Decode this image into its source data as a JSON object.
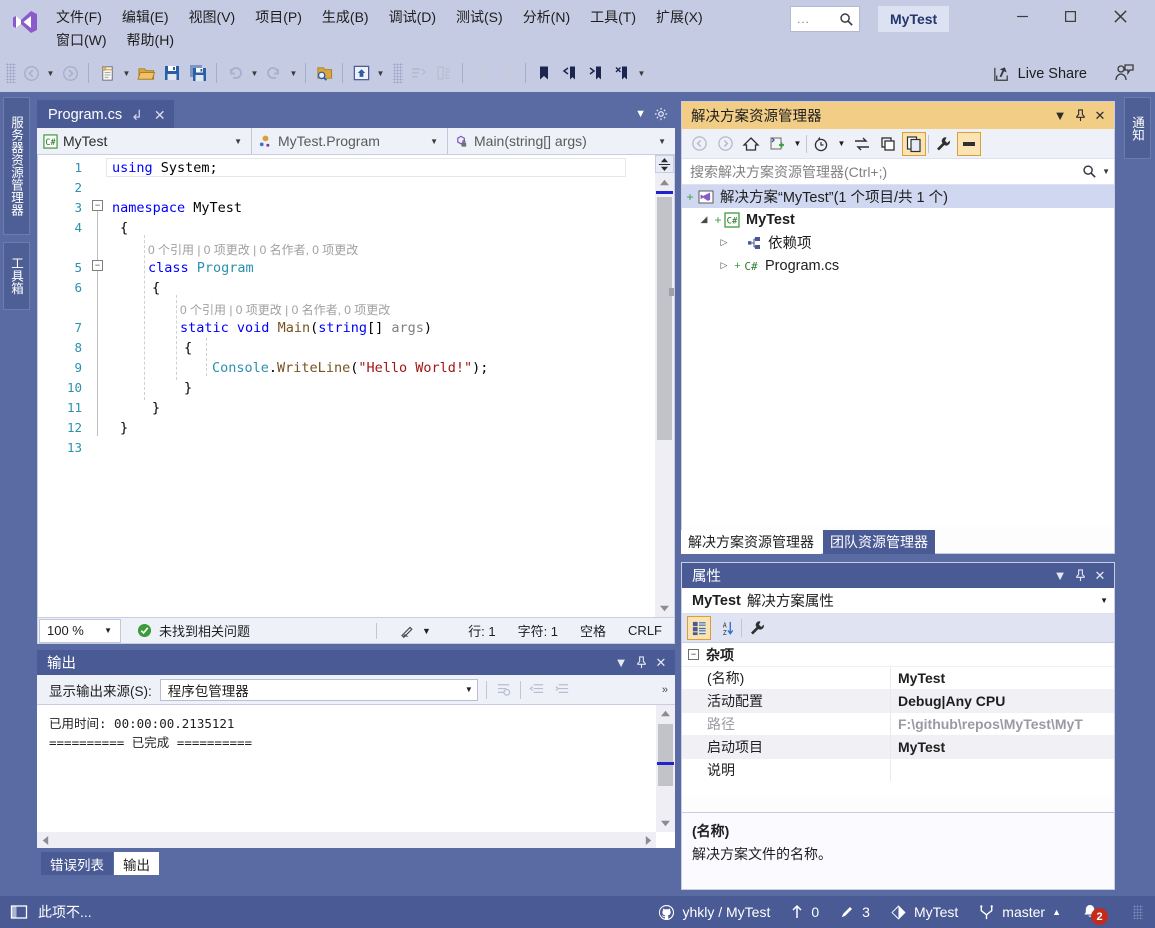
{
  "window": {
    "title": "MyTest",
    "minimize_label": "–",
    "maximize_label": "☐",
    "close_label": "✕"
  },
  "menu": {
    "row1": [
      {
        "label": "文件(F)",
        "key": "F"
      },
      {
        "label": "编辑(E)",
        "key": "E"
      },
      {
        "label": "视图(V)",
        "key": "V"
      },
      {
        "label": "项目(P)",
        "key": "P"
      },
      {
        "label": "生成(B)",
        "key": "B"
      },
      {
        "label": "调试(D)",
        "key": "D"
      },
      {
        "label": "测试(S)",
        "key": "S"
      },
      {
        "label": "分析(N)",
        "key": "N"
      },
      {
        "label": "工具(T)",
        "key": "T"
      },
      {
        "label": "扩展(X)",
        "key": "X"
      }
    ],
    "row2": [
      {
        "label": "窗口(W)",
        "key": "W"
      },
      {
        "label": "帮助(H)",
        "key": "H"
      }
    ]
  },
  "quick_search": {
    "dots": "...",
    "icon": "search-icon"
  },
  "toolbar": {
    "live_share": "Live Share",
    "icons": [
      "navigate-back-icon",
      "navigate-forward-icon",
      "new-item-icon",
      "open-file-icon",
      "save-icon",
      "save-all-icon",
      "undo-icon",
      "redo-icon",
      "find-icon",
      "start-page-icon",
      "comment-icon",
      "uncomment-icon",
      "outdent-icon",
      "indent-icon",
      "bookmark-icon",
      "prev-bookmark-icon",
      "next-bookmark-icon",
      "clear-bookmark-icon",
      "overflow-icon"
    ]
  },
  "left_tabs": [
    {
      "label": "服务器资源管理器",
      "name": "server-explorer"
    },
    {
      "label": "工具箱",
      "name": "toolbox"
    }
  ],
  "right_tabs": [
    {
      "label": "通知",
      "name": "notifications"
    }
  ],
  "editor": {
    "tab_label": "Program.cs",
    "pin_glyph": "↲",
    "close_glyph": "✕",
    "nav": {
      "project": "MyTest",
      "project_icon": "csharp-icon",
      "type": "MyTest.Program",
      "type_icon": "class-icon",
      "member": "Main(string[] args)",
      "member_icon": "method-private-icon"
    },
    "line_numbers": [
      "1",
      "2",
      "3",
      "4",
      "5",
      "6",
      "7",
      "8",
      "9",
      "10",
      "11",
      "12",
      "13"
    ],
    "code": [
      {
        "line": 1,
        "tokens": [
          {
            "t": "using",
            "c": "kw"
          },
          {
            "t": " System;",
            "c": "id"
          }
        ]
      },
      {
        "line": 3,
        "tokens": [
          {
            "t": "namespace",
            "c": "kw"
          },
          {
            "t": " ",
            "c": "id"
          },
          {
            "t": "MyTest",
            "c": "id"
          }
        ]
      },
      {
        "line": 4,
        "tokens": [
          {
            "t": "{",
            "c": "id"
          }
        ]
      },
      {
        "line": 5,
        "tokens": [
          {
            "t": "class",
            "c": "kw"
          },
          {
            "t": " ",
            "c": "id"
          },
          {
            "t": "Program",
            "c": "tp"
          }
        ]
      },
      {
        "line": 6,
        "tokens": [
          {
            "t": "{",
            "c": "id"
          }
        ]
      },
      {
        "line": 7,
        "tokens": [
          {
            "t": "static",
            "c": "kw"
          },
          {
            "t": " ",
            "c": "id"
          },
          {
            "t": "void",
            "c": "kw"
          },
          {
            "t": " ",
            "c": "id"
          },
          {
            "t": "Main",
            "c": "mth"
          },
          {
            "t": "(",
            "c": "id"
          },
          {
            "t": "string",
            "c": "kw"
          },
          {
            "t": "[] ",
            "c": "id"
          },
          {
            "t": "args",
            "c": "prm"
          },
          {
            "t": ")",
            "c": "id"
          }
        ]
      },
      {
        "line": 8,
        "tokens": [
          {
            "t": "{",
            "c": "id"
          }
        ]
      },
      {
        "line": 9,
        "tokens": [
          {
            "t": "Console",
            "c": "tp"
          },
          {
            "t": ".",
            "c": "id"
          },
          {
            "t": "WriteLine",
            "c": "mth"
          },
          {
            "t": "(",
            "c": "id"
          },
          {
            "t": "\"Hello World!\"",
            "c": "str"
          },
          {
            "t": ");",
            "c": "id"
          }
        ]
      },
      {
        "line": 10,
        "tokens": [
          {
            "t": "}",
            "c": "id"
          }
        ]
      },
      {
        "line": 11,
        "tokens": [
          {
            "t": "}",
            "c": "id"
          }
        ]
      },
      {
        "line": 12,
        "tokens": [
          {
            "t": "}",
            "c": "id"
          }
        ]
      }
    ],
    "codelens": [
      {
        "text": "0 个引用 | 0 项更改 | 0 名作者, 0 项更改"
      },
      {
        "text": "0 个引用 | 0 项更改 | 0 名作者, 0 项更改"
      },
      {
        "text": "0 个引用 | 0 项更改 | 0 名作者, 0 项更改"
      }
    ],
    "status": {
      "zoom": "100 %",
      "issues": "未找到相关问题",
      "issues_icon": "check-circle-icon",
      "pen_icon": "ink-icon",
      "line_label": "行: 1",
      "char_label": "字符: 1",
      "indent": "空格",
      "eol": "CRLF"
    }
  },
  "output_panel": {
    "title": "输出",
    "source_label": "显示输出来源(S):",
    "source_value": "程序包管理器",
    "lines": [
      "已用时间: 00:00:00.2135121",
      "========== 已完成 =========="
    ],
    "tabs": [
      {
        "label": "错误列表",
        "active": false
      },
      {
        "label": "输出",
        "active": true
      }
    ],
    "buttons": [
      "find-message-icon",
      "clear-all-icon",
      "wrap-text-icon",
      "overflow-icon"
    ]
  },
  "solution_explorer": {
    "title": "解决方案资源管理器",
    "search_placeholder": "搜索解决方案资源管理器(Ctrl+;)",
    "toolbar_icons": [
      "back-icon",
      "forward-icon",
      "home-icon",
      "add-item-icon",
      "chevron-down-icon",
      "pending-changes-icon",
      "sync-icon",
      "collapse-all-icon",
      "show-all-files-icon",
      "properties-icon",
      "preview-icon"
    ],
    "tree": [
      {
        "label": "解决方案“MyTest”(1 个项目/共 1 个)",
        "icon": "solution-icon",
        "depth": 0,
        "twisty": "",
        "selected": true,
        "bold": false
      },
      {
        "label": "MyTest",
        "icon": "csharp-project-icon",
        "depth": 1,
        "twisty": "◢",
        "selected": false,
        "bold": true
      },
      {
        "label": "依赖项",
        "icon": "dependencies-icon",
        "depth": 2,
        "twisty": "▷",
        "selected": false,
        "bold": false
      },
      {
        "label": "Program.cs",
        "icon": "csharp-file-icon",
        "depth": 2,
        "twisty": "▷",
        "selected": false,
        "bold": false
      }
    ],
    "tabs": [
      {
        "label": "解决方案资源管理器",
        "active": true
      },
      {
        "label": "团队资源管理器",
        "active": false
      }
    ]
  },
  "properties": {
    "title": "属性",
    "object_name": "MyTest",
    "object_type": "解决方案属性",
    "toolbar_icons": [
      "categorized-icon",
      "alphabetical-icon",
      "property-pages-icon"
    ],
    "category": "杂项",
    "rows": [
      {
        "key": "(名称)",
        "value": "MyTest",
        "dim": false
      },
      {
        "key": "活动配置",
        "value": "Debug|Any CPU",
        "dim": false
      },
      {
        "key": "路径",
        "value": "F:\\github\\repos\\MyTest\\MyT",
        "dim": true
      },
      {
        "key": "启动项目",
        "value": "MyTest",
        "dim": false
      },
      {
        "key": "说明",
        "value": "",
        "dim": false
      }
    ],
    "description_title": "(名称)",
    "description_text": "解决方案文件的名称。"
  },
  "status_bar": {
    "left_text": "此项不...",
    "repo": "yhkly / MyTest",
    "repo_icon": "github-icon",
    "up_count": "0",
    "up_icon": "arrow-up-icon",
    "edit_count": "3",
    "edit_icon": "pencil-icon",
    "project": "MyTest",
    "project_icon": "source-control-icon",
    "branch": "master",
    "branch_icon": "branch-icon",
    "branch_arrow": "▲",
    "notify_count": "2",
    "notify_icon": "bell-icon"
  },
  "colors": {
    "chrome": "#c5cbe3",
    "dock_bg": "#5a6ba3",
    "panel_header": "#4a5a94",
    "solution_header": "#f2cd86",
    "accent_blue": "#2b91af",
    "keyword": "#0000ff",
    "string": "#a31515",
    "badge_red": "#c42b1c"
  }
}
